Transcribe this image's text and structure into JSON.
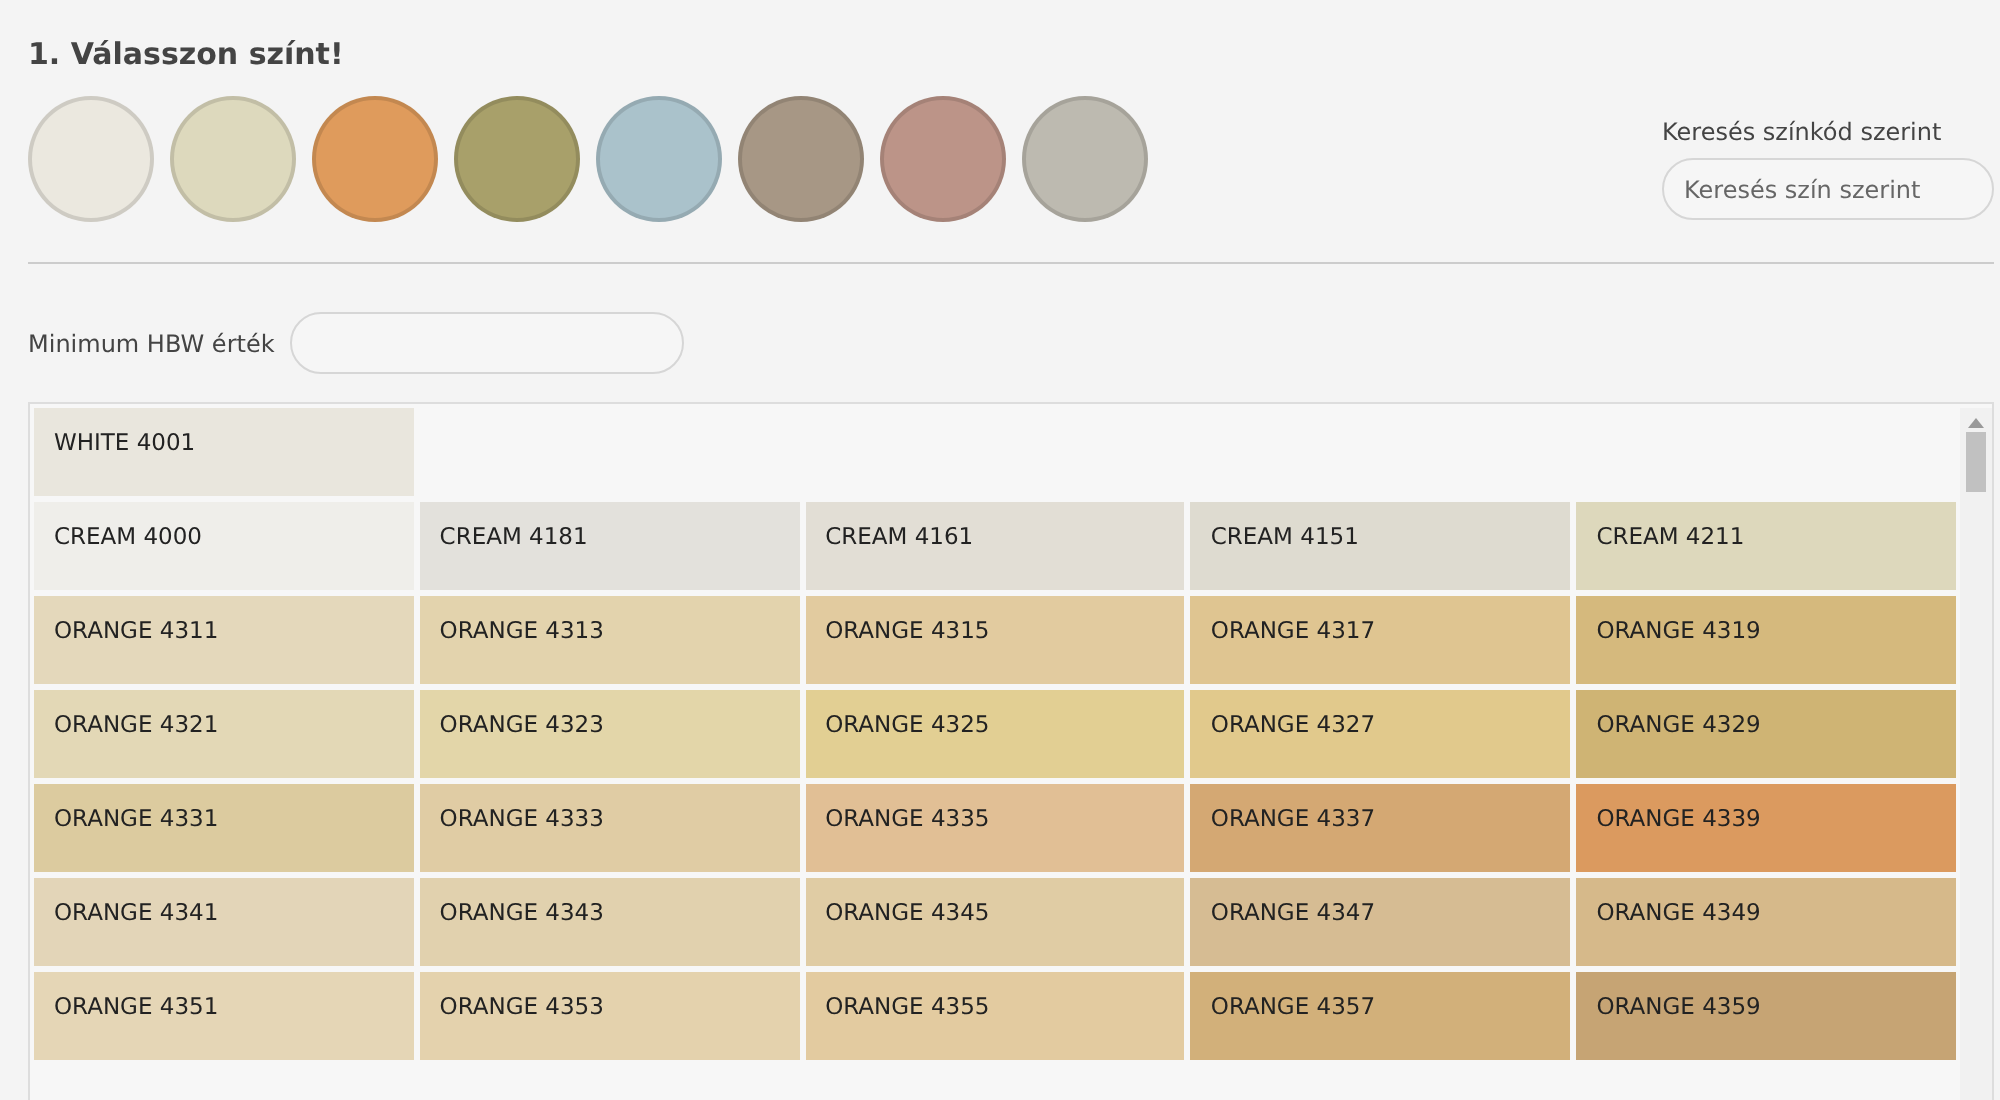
{
  "title": "1. Válasszon színt!",
  "swatches": [
    {
      "color": "#ebe8df"
    },
    {
      "color": "#ddd9bd"
    },
    {
      "color": "#df9b5c"
    },
    {
      "color": "#a8a06a"
    },
    {
      "color": "#aac2cb"
    },
    {
      "color": "#a79785"
    },
    {
      "color": "#bc9488"
    },
    {
      "color": "#bdbab0"
    }
  ],
  "code_search": {
    "label": "Keresés színkód szerint",
    "placeholder": "Keresés szín szerint"
  },
  "hbw_filter": {
    "label": "Minimum HBW érték"
  },
  "color_rows": [
    [
      {
        "name": "WHITE 4001",
        "color": "#e9e6dd"
      }
    ],
    [
      {
        "name": "CREAM 4000",
        "color": "#efeeea"
      },
      {
        "name": "CREAM 4181",
        "color": "#e3e1dc"
      },
      {
        "name": "CREAM 4161",
        "color": "#e2ded5"
      },
      {
        "name": "CREAM 4151",
        "color": "#dedbd0"
      },
      {
        "name": "CREAM 4211",
        "color": "#ddd8bc"
      }
    ],
    [
      {
        "name": "ORANGE 4311",
        "color": "#e4d8bb"
      },
      {
        "name": "ORANGE 4313",
        "color": "#e3d3ad"
      },
      {
        "name": "ORANGE 4315",
        "color": "#e2cb9f"
      },
      {
        "name": "ORANGE 4317",
        "color": "#dfc591"
      },
      {
        "name": "ORANGE 4319",
        "color": "#d5b97d"
      }
    ],
    [
      {
        "name": "ORANGE 4321",
        "color": "#e3d8b6"
      },
      {
        "name": "ORANGE 4323",
        "color": "#e3d6a9"
      },
      {
        "name": "ORANGE 4325",
        "color": "#e2cf93"
      },
      {
        "name": "ORANGE 4327",
        "color": "#e1c98c"
      },
      {
        "name": "ORANGE 4329",
        "color": "#cfb474"
      }
    ],
    [
      {
        "name": "ORANGE 4331",
        "color": "#dccb9f"
      },
      {
        "name": "ORANGE 4333",
        "color": "#e0cca4"
      },
      {
        "name": "ORANGE 4335",
        "color": "#e1bf95"
      },
      {
        "name": "ORANGE 4337",
        "color": "#d4a873"
      },
      {
        "name": "ORANGE 4339",
        "color": "#db9a5f"
      }
    ],
    [
      {
        "name": "ORANGE 4341",
        "color": "#e3d5b8"
      },
      {
        "name": "ORANGE 4343",
        "color": "#e1d1ae"
      },
      {
        "name": "ORANGE 4345",
        "color": "#e0cca4"
      },
      {
        "name": "ORANGE 4347",
        "color": "#d6bc93"
      },
      {
        "name": "ORANGE 4349",
        "color": "#d6b98a"
      }
    ],
    [
      {
        "name": "ORANGE 4351",
        "color": "#e5d6b6"
      },
      {
        "name": "ORANGE 4353",
        "color": "#e4d2ad"
      },
      {
        "name": "ORANGE 4355",
        "color": "#e3cba0"
      },
      {
        "name": "ORANGE 4357",
        "color": "#d2b07a"
      },
      {
        "name": "ORANGE 4359",
        "color": "#c6a474"
      }
    ]
  ]
}
